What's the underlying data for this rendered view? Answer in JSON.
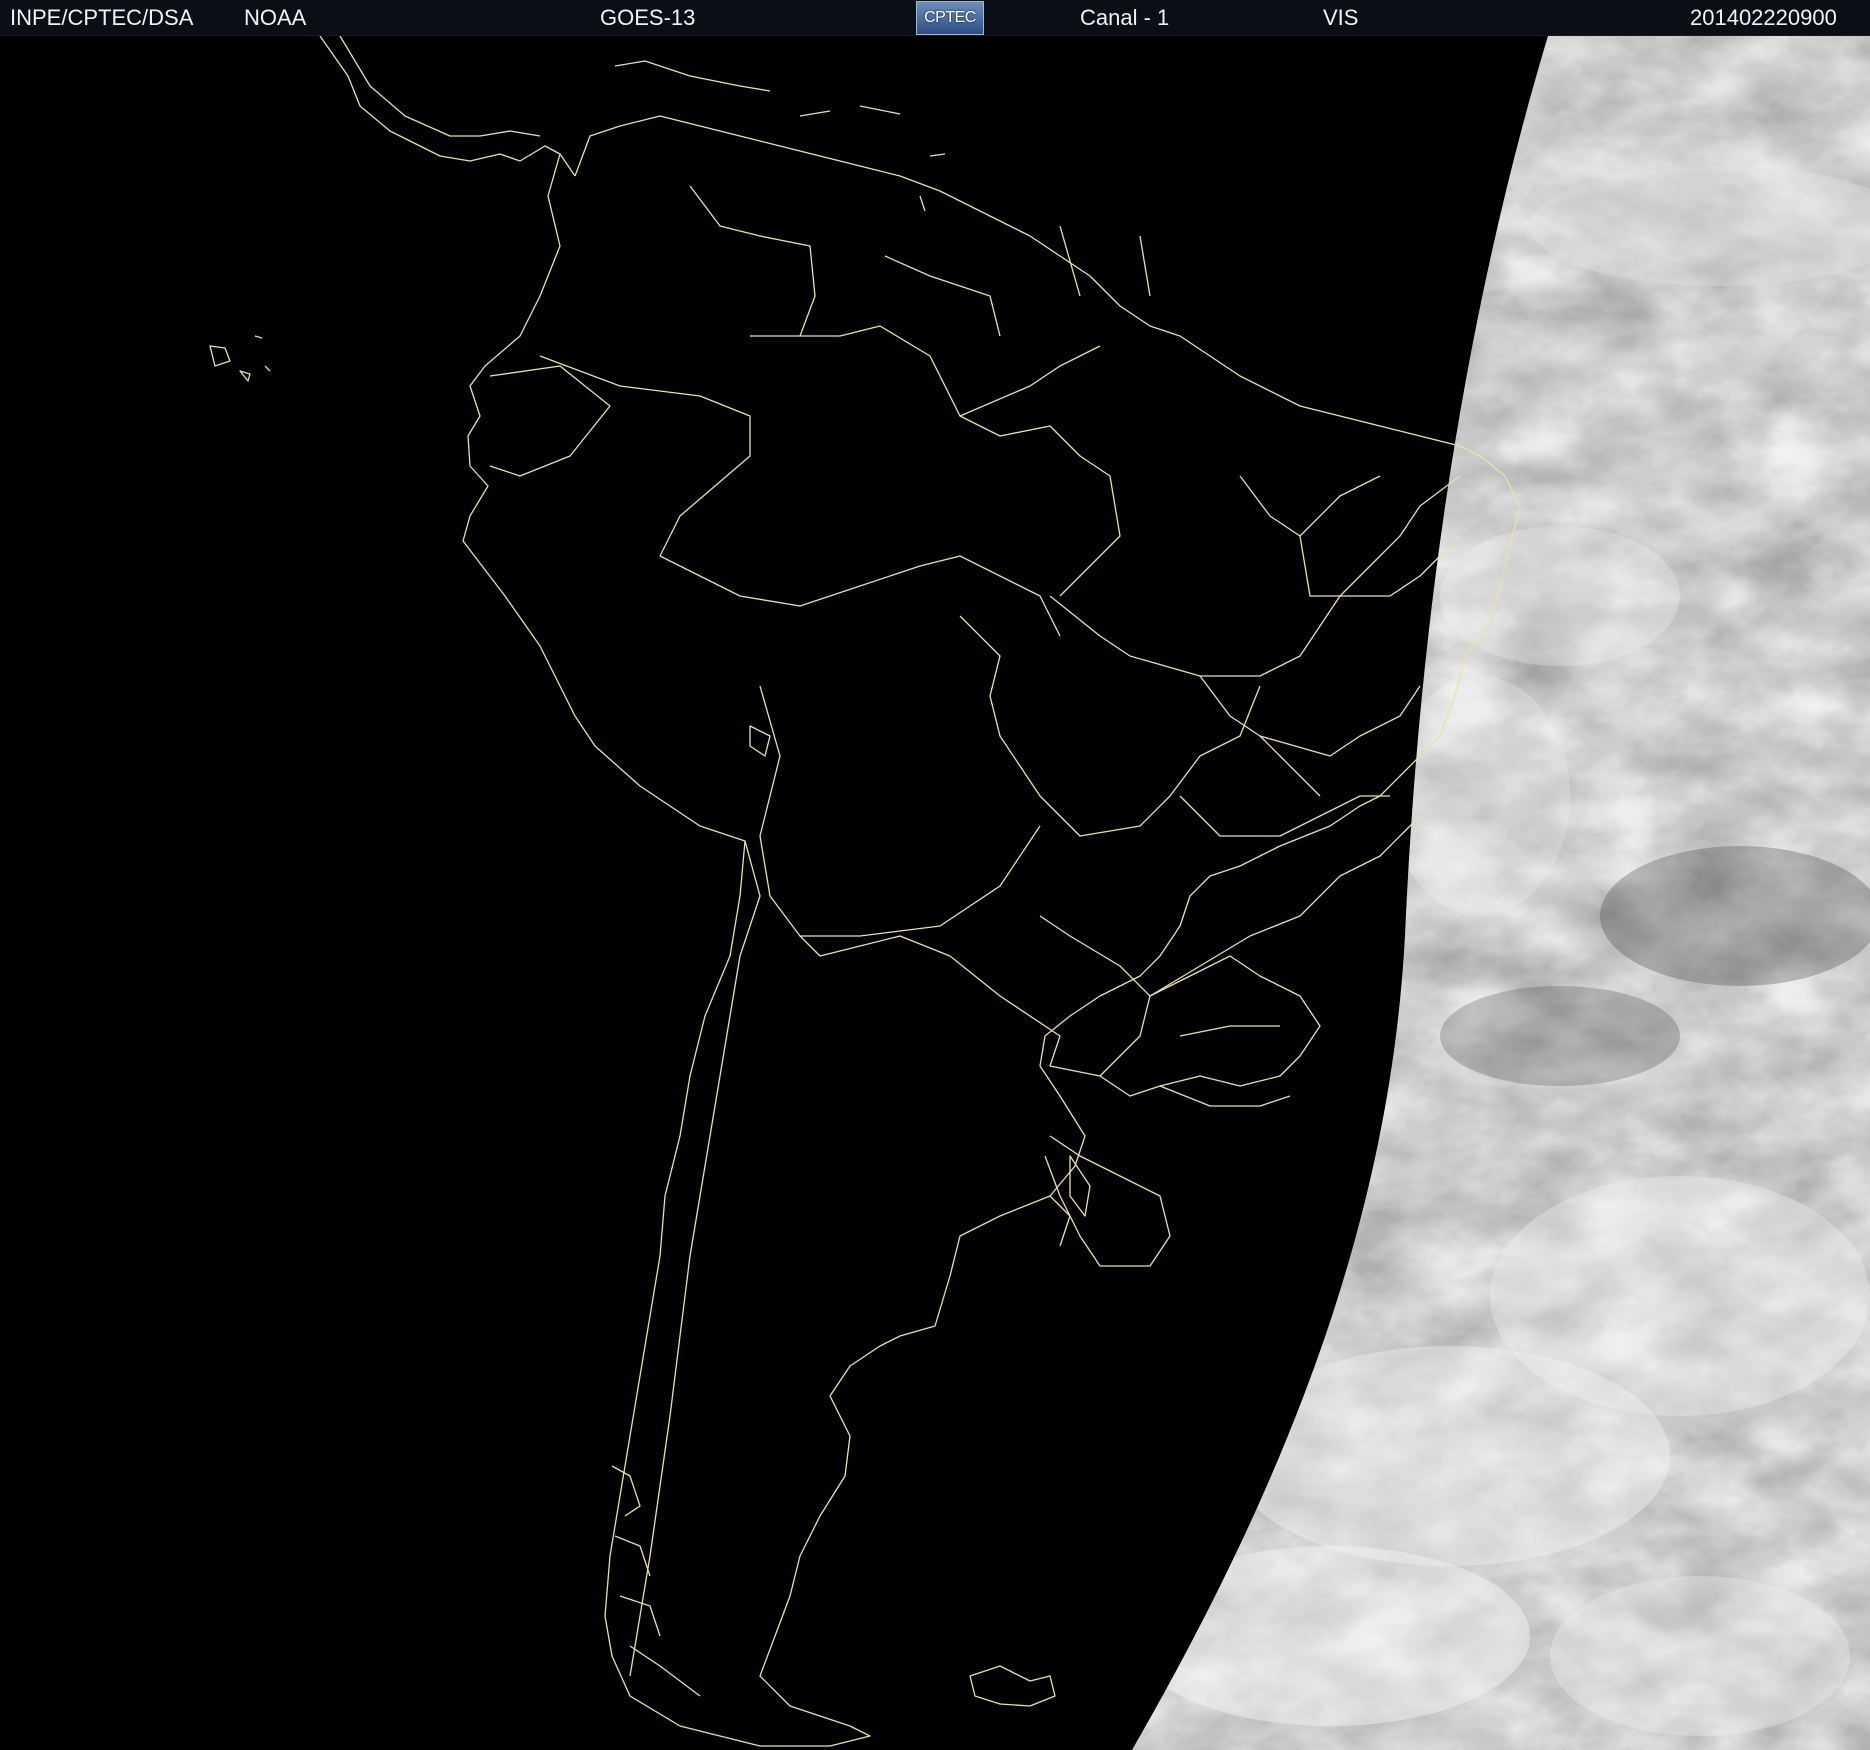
{
  "header": {
    "org": "INPE/CPTEC/DSA",
    "agency": "NOAA",
    "satellite": "GOES-13",
    "logo_text": "CPTEC",
    "channel": "Canal - 1",
    "band": "VIS",
    "timestamp": "201402220900"
  },
  "map": {
    "region": "South America",
    "coastline_color": "#e9e2a8",
    "night_color": "#000000",
    "day_cloud_colors": [
      "#4f4f4f",
      "#7a7a7a",
      "#b8b8b8",
      "#f0f0f0"
    ]
  }
}
